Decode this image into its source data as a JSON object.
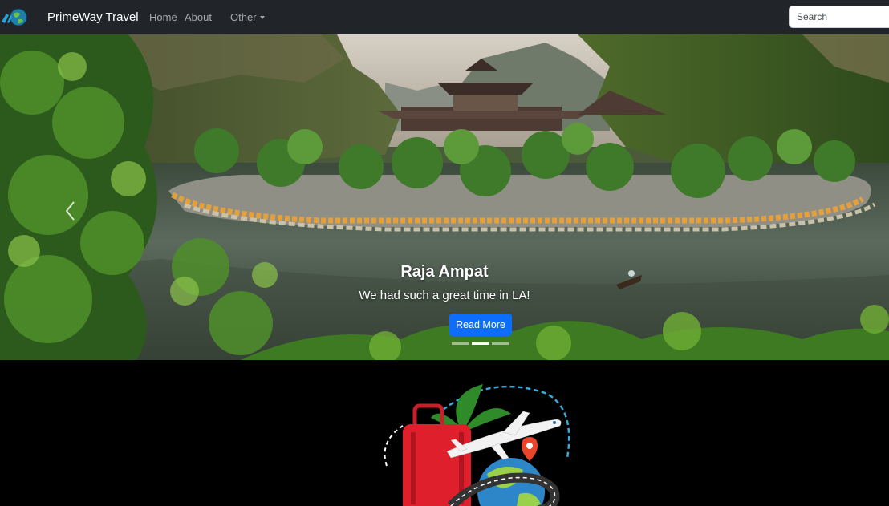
{
  "navbar": {
    "brand": "PrimeWay Travel",
    "links": [
      {
        "label": "Home"
      },
      {
        "label": "About"
      },
      {
        "label": "Other"
      }
    ],
    "search_placeholder": "Search"
  },
  "carousel": {
    "slide": {
      "title": "Raja Ampat",
      "text": "We had such a great time in LA!",
      "button": "Read More"
    },
    "indicators": 3,
    "active_indicator": 2
  },
  "colors": {
    "navbar_bg": "#212529",
    "primary": "#0d6efd",
    "page_bg": "#000000"
  },
  "icons": [
    "globe-logo-icon",
    "chevron-left-icon",
    "travel-illustration"
  ]
}
